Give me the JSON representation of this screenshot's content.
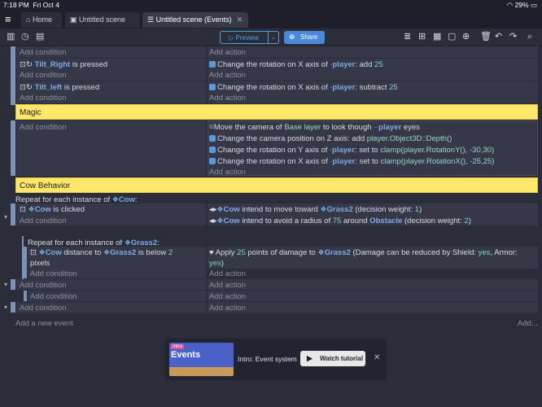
{
  "status": {
    "time": "7:18 PM",
    "date": "Fri Oct 4",
    "battery": "29%"
  },
  "tabs": [
    {
      "label": "Home",
      "close": "✕"
    },
    {
      "label": "Untitled scene",
      "close": "✕"
    },
    {
      "label": "Untitled scene (Events)",
      "close": "✕"
    }
  ],
  "toolbar": {
    "preview": "Preview",
    "share": "Share"
  },
  "ph": {
    "cond": "Add condition",
    "act": "Add action"
  },
  "events": {
    "tilt_right": {
      "obj": "Tilt_Right",
      "suffix": " is pressed",
      "act_pre": "Change the rotation on X axis of",
      "act_obj": "player",
      "act_mid": ": add",
      "act_num": "25"
    },
    "tilt_left": {
      "obj": "Tilt_left",
      "suffix": " is pressed",
      "act_pre": "Change the rotation on X axis of",
      "act_obj": "player",
      "act_mid": ": subtract",
      "act_num": "25"
    },
    "magic_group": "Magic",
    "magic": [
      {
        "pre": "Move the camera of",
        "layer": "Base layer",
        "mid": " to look though ",
        "obj": "player",
        "post": " eyes"
      },
      {
        "pre": "Change the camera position on Z axis: add",
        "expr": "player.Object3D::Depth()"
      },
      {
        "pre": "Change the rotation on Y axis of",
        "obj": "player",
        "mid": ": set to",
        "expr": "clamp(player.RotationY(), -30,30)"
      },
      {
        "pre": "Change the rotation on X axis of",
        "obj": "player",
        "mid": ": set to",
        "expr": "clamp(player.RotationX(), -25,25)"
      }
    ],
    "cow_group": "Cow Behavior",
    "repeat1": {
      "pre": "Repeat for each instance of",
      "obj": "Cow",
      "post": ":"
    },
    "cow_clicked": {
      "obj": "Cow",
      "suffix": " is clicked"
    },
    "cow_act1": {
      "obj": "Cow",
      "mid": " intend to move toward ",
      "target": "Grass2",
      "post": " (decision weight: ",
      "num": "1",
      "end": ")"
    },
    "cow_act2": {
      "obj": "Cow",
      "mid": " intend to avoid a radius of ",
      "num": "75",
      "mid2": " around ",
      "target": "Obstacle",
      "post": " (decision weight: ",
      "num2": "2",
      "end": ")"
    },
    "repeat2": {
      "pre": "Repeat for each instance of",
      "obj": "Grass2",
      "post": ":"
    },
    "dist": {
      "obj": "Cow",
      "mid": " distance to ",
      "target": "Grass2",
      "post": " is below ",
      "num": "2",
      "unit": "pixels"
    },
    "damage": {
      "pre": "Apply ",
      "num": "25",
      "mid": " points of damage to ",
      "target": "Grass2",
      "post": " (Damage can be reduced by Shield: ",
      "yes": "yes",
      "armor": ", Armor:",
      "yes2": "yes",
      ")": ")"
    }
  },
  "footer": {
    "add_event": "Add a new event",
    "add_more": "Add..."
  },
  "tutorial": {
    "badge": "Intro",
    "thumb_title": "Events",
    "text": "Intro: Event system",
    "button": "Watch tutorial",
    "close": "✕"
  }
}
